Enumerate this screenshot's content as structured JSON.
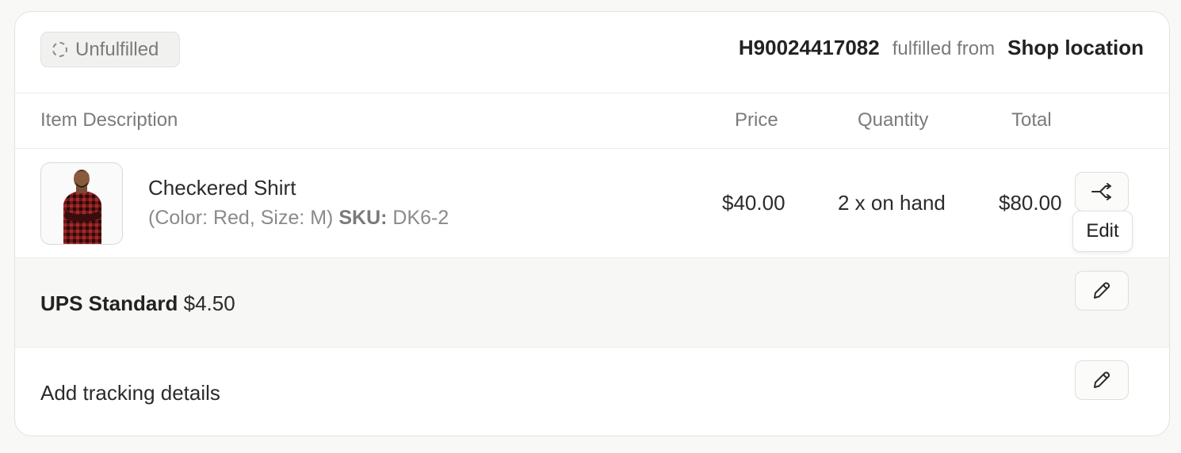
{
  "status_badge": {
    "label": "Unfulfilled"
  },
  "order": {
    "id": "H90024417082",
    "fulfilled_from_text": "fulfilled from",
    "location": "Shop location"
  },
  "table": {
    "headers": {
      "description": "Item Description",
      "price": "Price",
      "quantity": "Quantity",
      "total": "Total"
    }
  },
  "item": {
    "name": "Checkered Shirt",
    "variant": "(Color: Red, Size: M)",
    "sku_label": "SKU:",
    "sku": "DK6-2",
    "price": "$40.00",
    "quantity": "2 x on hand",
    "total": "$80.00",
    "image_icon": "product-photo"
  },
  "tooltip": {
    "label": "Edit"
  },
  "shipping": {
    "method": "UPS Standard",
    "cost": "$4.50"
  },
  "tracking": {
    "label": "Add tracking details"
  },
  "icons": {
    "split": "split-arrow-icon",
    "edit": "pencil-icon",
    "status": "dashed-circle-icon"
  },
  "colors": {
    "background": "#f8f8f7",
    "card": "#ffffff",
    "muted_text": "#7b7b7b",
    "shipping_row_bg": "#f7f7f6"
  }
}
